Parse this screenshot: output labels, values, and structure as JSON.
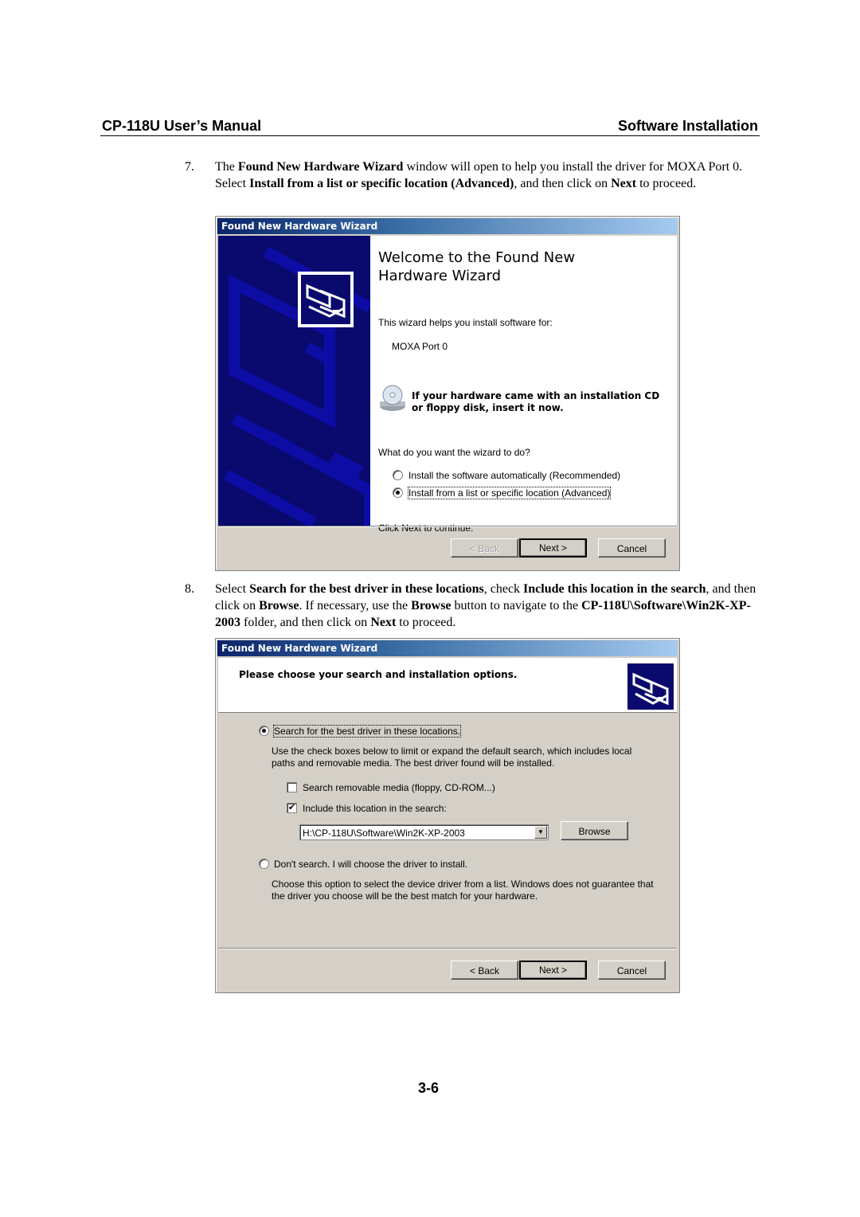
{
  "header": {
    "left": "CP-118U User’s Manual",
    "right": "Software Installation"
  },
  "steps": [
    {
      "number": "7.",
      "parts": [
        {
          "t": "The ",
          "b": false
        },
        {
          "t": "Found New Hardware Wizard",
          "b": true
        },
        {
          "t": " window will open to help you install the driver for MOXA Port 0. Select ",
          "b": false
        },
        {
          "t": "Install from a list or specific location (Advanced)",
          "b": true
        },
        {
          "t": ", and then click on ",
          "b": false
        },
        {
          "t": "Next",
          "b": true
        },
        {
          "t": " to proceed.",
          "b": false
        }
      ]
    },
    {
      "number": "8.",
      "parts": [
        {
          "t": "Select ",
          "b": false
        },
        {
          "t": "Search for the best driver in these locations",
          "b": true
        },
        {
          "t": ", check ",
          "b": false
        },
        {
          "t": "Include this location in the search",
          "b": true
        },
        {
          "t": ", and then click on ",
          "b": false
        },
        {
          "t": "Browse",
          "b": true
        },
        {
          "t": ". If necessary, use the ",
          "b": false
        },
        {
          "t": "Browse",
          "b": true
        },
        {
          "t": " button to navigate to the ",
          "b": false
        },
        {
          "t": "CP-118U\\Software\\Win2K-XP-2003",
          "b": true
        },
        {
          "t": " folder, and then click on ",
          "b": false
        },
        {
          "t": "Next",
          "b": true
        },
        {
          "t": " to proceed.",
          "b": false
        }
      ]
    }
  ],
  "wizard1": {
    "title": "Found New Hardware Wizard",
    "heading_line1": "Welcome to the Found New",
    "heading_line2": "Hardware Wizard",
    "intro": "This wizard helps you install software for:",
    "device": "MOXA Port 0",
    "cd_notice_line1": "If your hardware came with an installation CD",
    "cd_notice_line2": "or floppy disk, insert it now.",
    "question": "What do you want the wizard to do?",
    "options": [
      {
        "label": "Install the software automatically (Recommended)",
        "selected": false
      },
      {
        "label": "Install from a list or specific location (Advanced)",
        "selected": true
      }
    ],
    "continue_hint": "Click Next to continue.",
    "buttons": {
      "back": "< Back",
      "next": "Next >",
      "cancel": "Cancel"
    },
    "back_enabled": false
  },
  "wizard2": {
    "title": "Found New Hardware Wizard",
    "heading": "Please choose your search and installation options.",
    "option_search": {
      "label": "Search for the best driver in these locations.",
      "selected": true
    },
    "search_desc_line1": "Use the check boxes below to limit or expand the default search, which includes local",
    "search_desc_line2": "paths and removable media. The best driver found will be installed.",
    "checkbox_removable": {
      "label": "Search removable media (floppy, CD-ROM...)",
      "checked": false
    },
    "checkbox_location": {
      "label": "Include this location in the search:",
      "checked": true
    },
    "location_value": "H:\\CP-118U\\Software\\Win2K-XP-2003",
    "browse_label": "Browse",
    "option_dont_search": {
      "label": "Don't search. I will choose the driver to install.",
      "selected": false
    },
    "dont_desc_line1": "Choose this option to select the device driver from a list.  Windows does not guarantee that",
    "dont_desc_line2": "the driver you choose will be the best match for your hardware.",
    "buttons": {
      "back": "< Back",
      "next": "Next >",
      "cancel": "Cancel"
    }
  },
  "page_number": "3-6"
}
